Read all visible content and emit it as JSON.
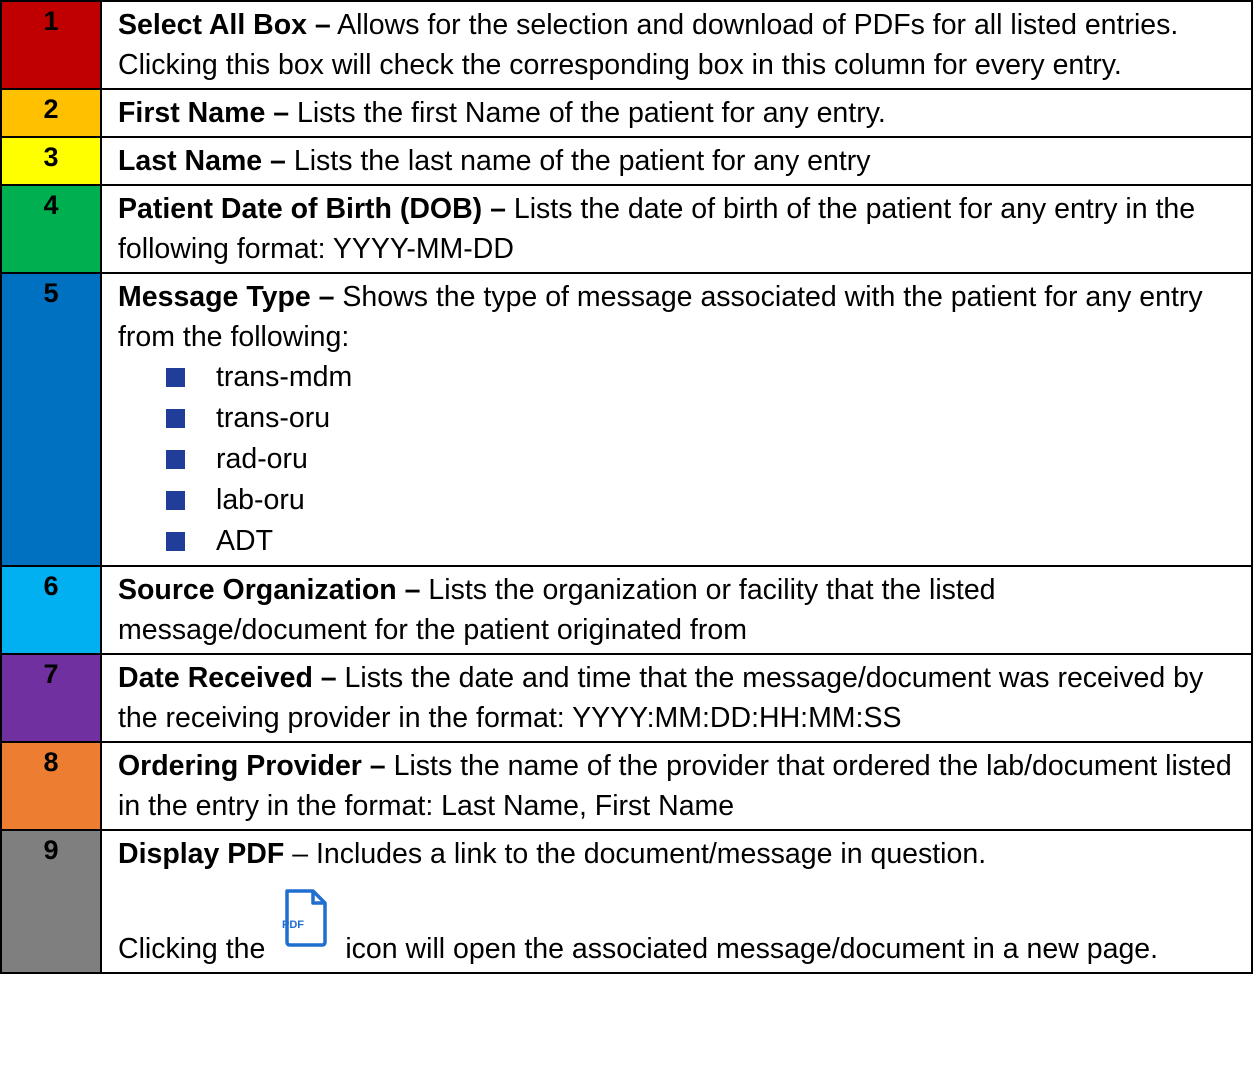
{
  "colors": {
    "row1": "#c00000",
    "row2": "#ffc000",
    "row3": "#ffff00",
    "row4": "#00b050",
    "row5": "#0070c0",
    "row6": "#00b0f0",
    "row7": "#7030a0",
    "row8": "#ed7d31",
    "row9": "#7f7f7f",
    "bullet": "#1f3d99"
  },
  "rows": [
    {
      "num": "1",
      "term": "Select All Box –",
      "text": " Allows for the selection and download of PDFs for all listed entries. Clicking this box will check the corresponding box in this column for every entry."
    },
    {
      "num": "2",
      "term": "First Name –",
      "text": " Lists the first Name of the patient for any entry."
    },
    {
      "num": "3",
      "term": "Last Name –",
      "text": " Lists the last name of the patient for any entry"
    },
    {
      "num": "4",
      "term": "Patient Date of Birth (DOB) –",
      "text": " Lists the date of birth of the patient for any entry in the following format: YYYY-MM-DD"
    },
    {
      "num": "5",
      "term": "Message Type –",
      "text": " Shows the type of message associated with the patient for any entry from the following:",
      "items": [
        "trans-mdm",
        "trans-oru",
        "rad-oru",
        "lab-oru",
        "ADT"
      ]
    },
    {
      "num": "6",
      "term": "Source Organization –",
      "text": " Lists the organization or facility that the listed message/document for the patient originated from"
    },
    {
      "num": "7",
      "term": "Date Received –",
      "text": " Lists the date and time that the message/document was received by the receiving provider in the format: YYYY:MM:DD:HH:MM:SS"
    },
    {
      "num": "8",
      "term": "Ordering Provider –",
      "text": " Lists the name of the provider that ordered the lab/document listed in the entry in the format: Last Name, First Name"
    },
    {
      "num": "9",
      "term": "Display PDF",
      "text": " – Includes a link to the document/message in question.",
      "click_before": "Clicking the",
      "click_after": "icon will open the associated message/document in a new page.",
      "icon_label": "PDF",
      "icon": "pdf-file-icon"
    }
  ]
}
